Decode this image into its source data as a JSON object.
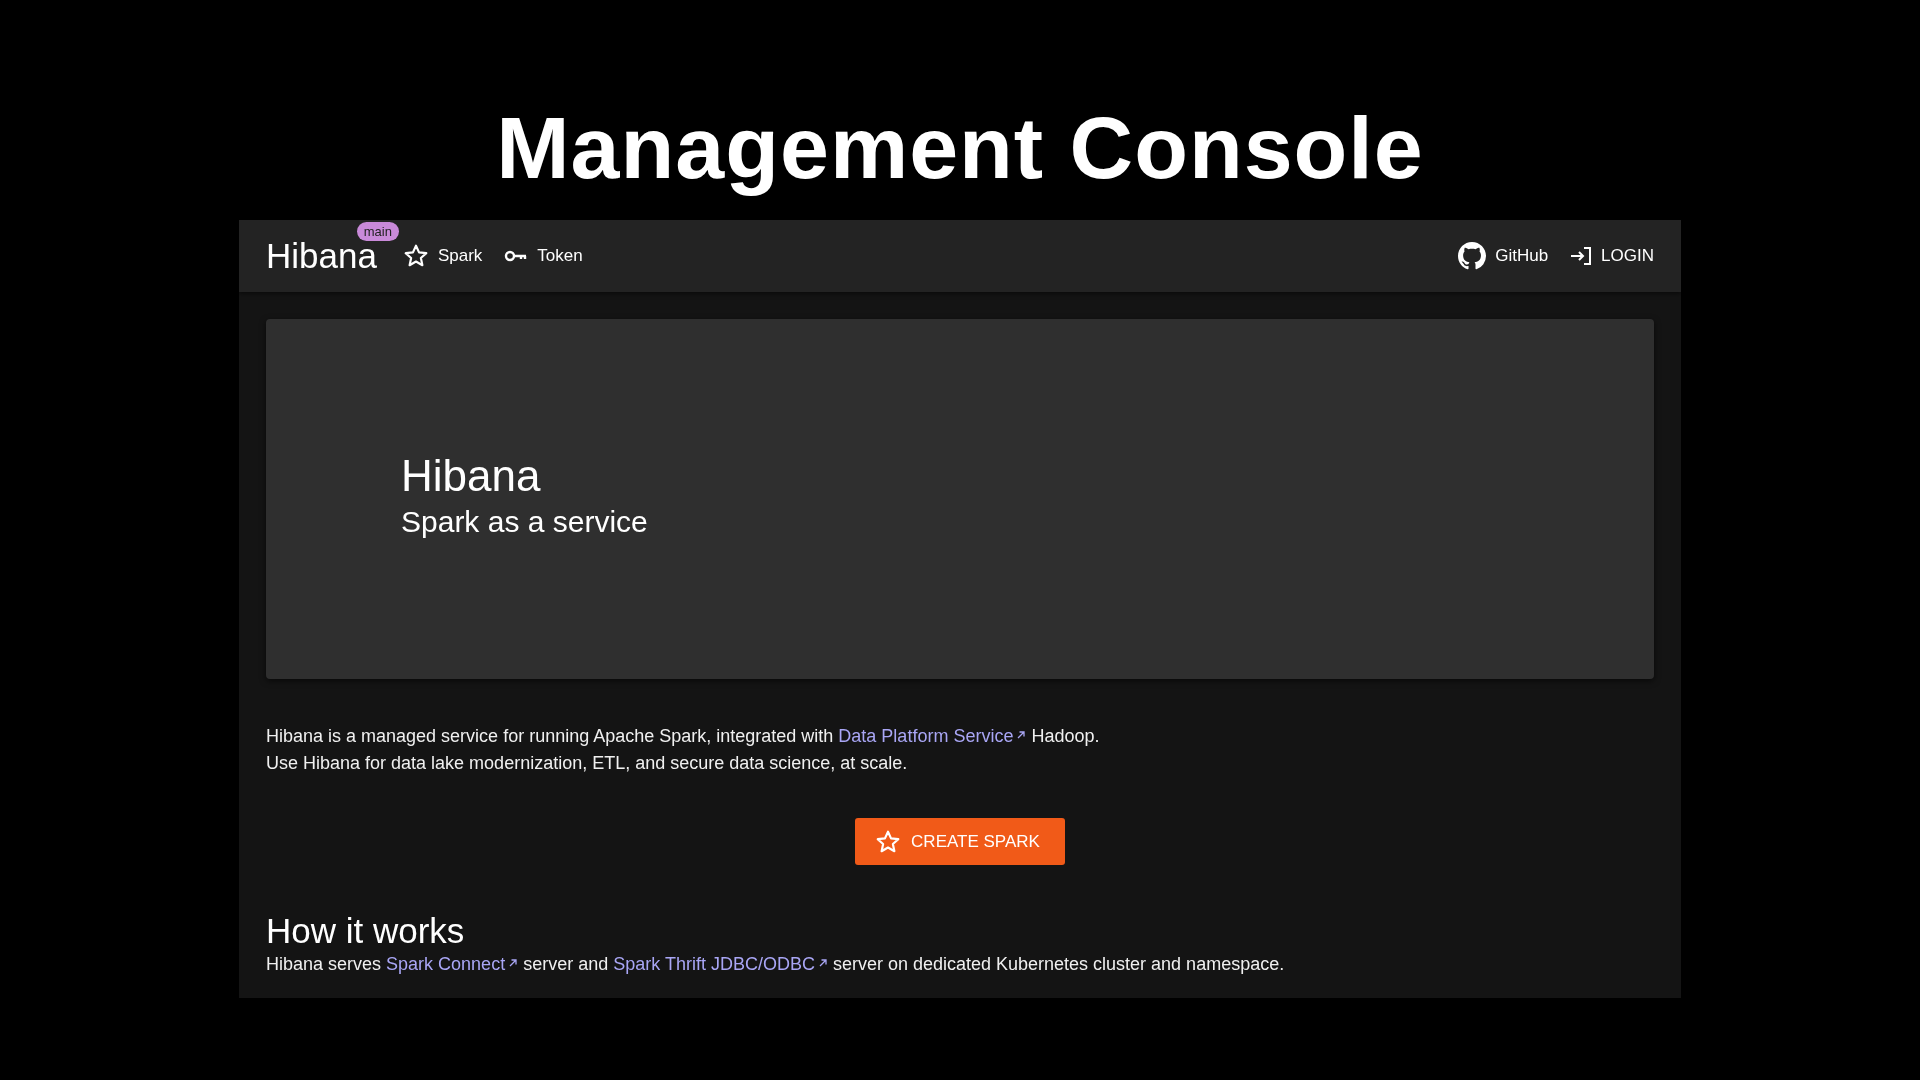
{
  "slide_title": "Management Console",
  "navbar": {
    "brand": "Hibana",
    "badge": "main",
    "nav_items": [
      "Spark",
      "Token"
    ],
    "right_items": [
      "GitHub",
      "LOGIN"
    ]
  },
  "hero": {
    "title": "Hibana",
    "subtitle": "Spark as a service"
  },
  "intro": [
    [
      {
        "kind": "text",
        "text": "Hibana is a managed service for running Apache Spark, integrated with "
      },
      {
        "kind": "link",
        "text": "Data Platform Service"
      },
      {
        "kind": "text",
        "text": " Hadoop."
      }
    ],
    [
      {
        "kind": "text",
        "text": "Use Hibana for data lake modernization, ETL, and secure data science, at scale."
      }
    ]
  ],
  "create_button": "CREATE SPARK",
  "how_it_works": {
    "heading": "How it works",
    "text": [
      {
        "kind": "text",
        "text": "Hibana serves "
      },
      {
        "kind": "link",
        "text": "Spark Connect"
      },
      {
        "kind": "text",
        "text": " server and "
      },
      {
        "kind": "link",
        "text": "Spark Thrift JDBC/ODBC"
      },
      {
        "kind": "text",
        "text": " server on dedicated Kubernetes cluster and namespace."
      }
    ]
  }
}
